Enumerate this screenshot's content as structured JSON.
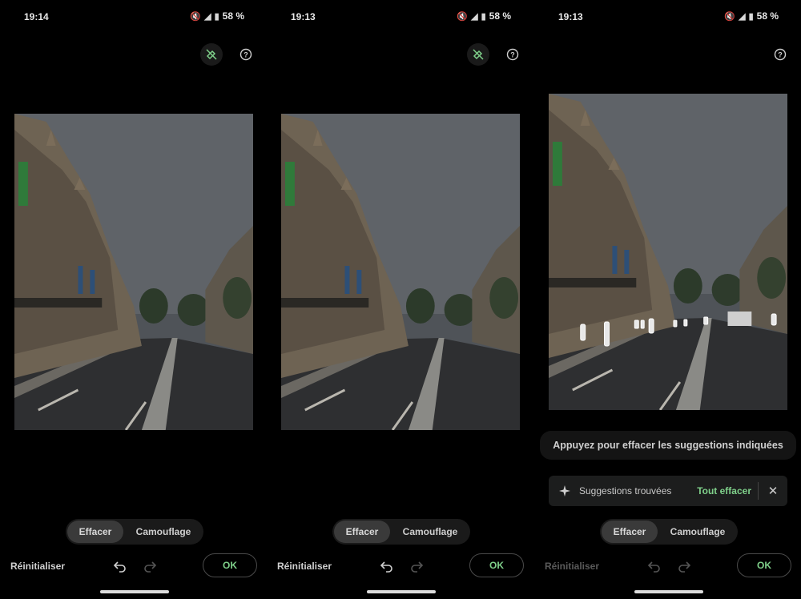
{
  "panels": [
    {
      "status": {
        "time": "19:14",
        "battery": "58 %"
      },
      "hint": null,
      "toolbar": {
        "erase": "Effacer",
        "camouflage": "Camouflage",
        "reset": "Réinitialiser",
        "ok": "OK"
      }
    },
    {
      "status": {
        "time": "19:13",
        "battery": "58 %"
      },
      "hint": null,
      "toolbar": {
        "erase": "Effacer",
        "camouflage": "Camouflage",
        "reset": "Réinitialiser",
        "ok": "OK"
      }
    },
    {
      "status": {
        "time": "19:13",
        "battery": "58 %"
      },
      "hint": "Appuyez pour effacer les suggestions indiquées",
      "suggestions": {
        "label": "Suggestions trouvées",
        "action": "Tout effacer"
      },
      "toolbar": {
        "erase": "Effacer",
        "camouflage": "Camouflage",
        "reset": "Réinitialiser",
        "ok": "OK"
      }
    }
  ],
  "icons": {
    "mute": "mute-icon",
    "signal": "signal-icon",
    "battery": "battery-icon",
    "magic_off": "magic-eraser-off-icon",
    "help": "help-icon",
    "undo": "undo-icon",
    "redo": "redo-icon",
    "sparkle": "sparkle-icon",
    "close": "close-icon"
  },
  "colors": {
    "accent": "#7fd08a",
    "background": "#000000"
  }
}
